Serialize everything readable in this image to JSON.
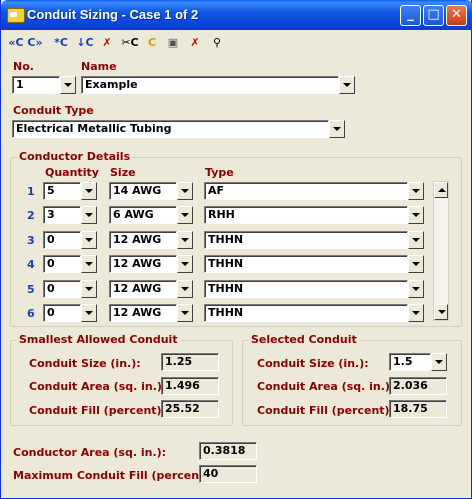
{
  "window": {
    "title": "Conduit Sizing - Case 1 of 2"
  },
  "titlebar_buttons": [
    "minimize",
    "maximize",
    "close"
  ],
  "toolbar": {
    "items": [
      {
        "icon": "first-case-icon",
        "label": "«C"
      },
      {
        "icon": "last-case-icon",
        "label": "C»"
      },
      {
        "icon": "new-case-icon",
        "label": "*C"
      },
      {
        "icon": "insert-case-icon",
        "label": "↓C"
      },
      {
        "icon": "delete-icon",
        "label": "✗"
      },
      {
        "icon": "cut-icon",
        "label": "✂C"
      },
      {
        "icon": "copy-icon",
        "label": "C"
      },
      {
        "icon": "paste-icon",
        "label": "▣"
      },
      {
        "icon": "delete-all-icon",
        "label": "✗"
      },
      {
        "icon": "zoom-icon",
        "label": "⚲"
      }
    ]
  },
  "header": {
    "no_label": "No.",
    "no_value": "1",
    "name_label": "Name",
    "name_value": "Example",
    "conduit_type_label": "Conduit Type",
    "conduit_type_value": "Electrical Metallic Tubing"
  },
  "conductor_details": {
    "title": "Conductor Details",
    "col_quantity": "Quantity",
    "col_size": "Size",
    "col_type": "Type",
    "rows": [
      {
        "num": "1",
        "quantity": "5",
        "size": "14 AWG",
        "type": "AF"
      },
      {
        "num": "2",
        "quantity": "3",
        "size": "6 AWG",
        "type": "RHH"
      },
      {
        "num": "3",
        "quantity": "0",
        "size": "12 AWG",
        "type": "THHN"
      },
      {
        "num": "4",
        "quantity": "0",
        "size": "12 AWG",
        "type": "THHN"
      },
      {
        "num": "5",
        "quantity": "0",
        "size": "12 AWG",
        "type": "THHN"
      },
      {
        "num": "6",
        "quantity": "0",
        "size": "12 AWG",
        "type": "THHN"
      }
    ]
  },
  "smallest": {
    "title": "Smallest Allowed Conduit",
    "size_label": "Conduit Size (in.):",
    "size_value": "1.25",
    "area_label": "Conduit Area (sq. in.):",
    "area_value": "1.496",
    "fill_label": "Conduit Fill (percent):",
    "fill_value": "25.52"
  },
  "selected": {
    "title": "Selected Conduit",
    "size_label": "Conduit Size (in.):",
    "size_value": "1.5",
    "area_label": "Conduit Area (sq. in.):",
    "area_value": "2.036",
    "fill_label": "Conduit Fill (percent):",
    "fill_value": "18.75"
  },
  "summary": {
    "conductor_area_label": "Conductor Area (sq. in.):",
    "conductor_area_value": "0.3818",
    "max_fill_label": "Maximum Conduit Fill (percent):",
    "max_fill_value": "40"
  }
}
